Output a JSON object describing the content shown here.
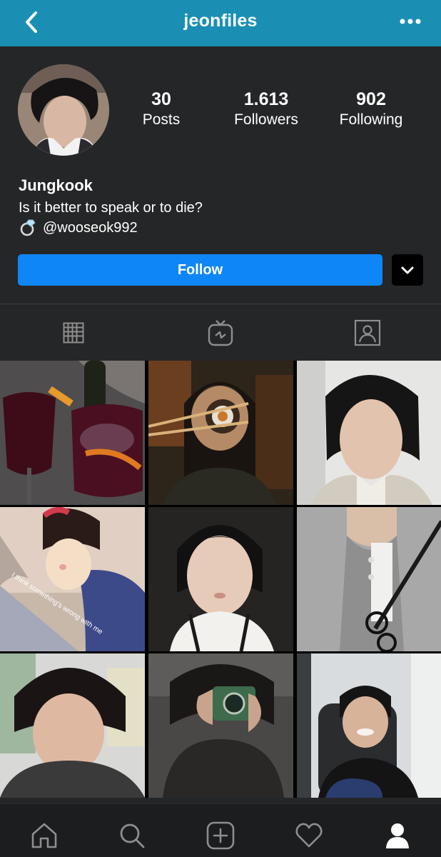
{
  "header": {
    "title": "jeonfiles"
  },
  "profile": {
    "stats": [
      {
        "value": "30",
        "label": "Posts"
      },
      {
        "value": "1.613",
        "label": "Followers"
      },
      {
        "value": "902",
        "label": "Following"
      }
    ],
    "name": "Jungkook",
    "bio": "Is it better to speak or to die?",
    "linked_account": "@wooseok992"
  },
  "actions": {
    "follow_label": "Follow"
  },
  "tabs": [
    {
      "icon": "grid-icon",
      "selected": true
    },
    {
      "icon": "igtv-icon",
      "selected": false
    },
    {
      "icon": "tagged-icon",
      "selected": false
    }
  ],
  "posts": [
    {
      "caption": ""
    },
    {
      "caption": ""
    },
    {
      "caption": ""
    },
    {
      "caption": "I think something's wrong with me"
    },
    {
      "caption": ""
    },
    {
      "caption": ""
    },
    {
      "caption": ""
    },
    {
      "caption": ""
    },
    {
      "caption": ""
    }
  ],
  "bottom_nav": [
    "home-icon",
    "search-icon",
    "new-post-icon",
    "activity-heart-icon",
    "profile-icon"
  ],
  "colors": {
    "header_bg": "#1a8fb3",
    "follow_button": "#0f86f5",
    "background": "#252628"
  }
}
